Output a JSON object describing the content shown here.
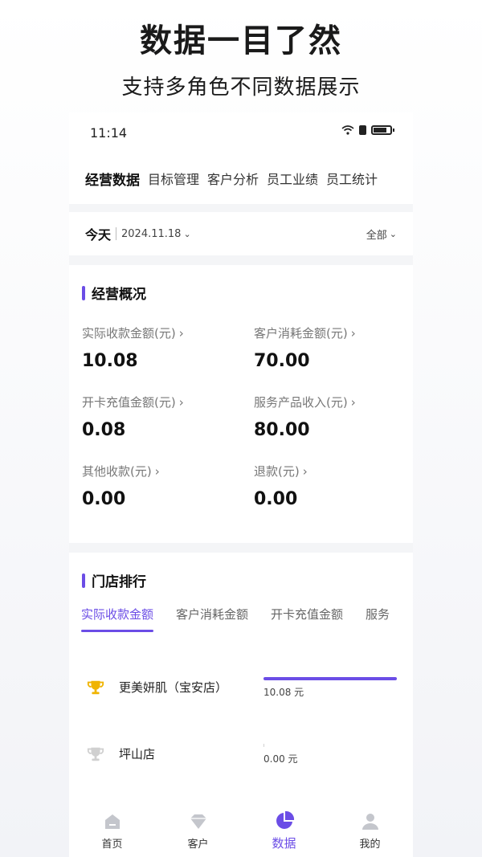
{
  "promo": {
    "title": "数据一目了然",
    "subtitle": "支持多角色不同数据展示"
  },
  "status_bar": {
    "time": "11:14"
  },
  "tabs": [
    {
      "label": "经营数据",
      "active": true
    },
    {
      "label": "目标管理",
      "active": false
    },
    {
      "label": "客户分析",
      "active": false
    },
    {
      "label": "员工业绩",
      "active": false
    },
    {
      "label": "员工统计",
      "active": false
    }
  ],
  "filter": {
    "today_label": "今天",
    "date": "2024.11.18",
    "scope": "全部"
  },
  "overview": {
    "title": "经营概况",
    "metrics": [
      {
        "label": "实际收款金额(元)",
        "value": "10.08"
      },
      {
        "label": "客户消耗金额(元)",
        "value": "70.00"
      },
      {
        "label": "开卡充值金额(元)",
        "value": "0.08"
      },
      {
        "label": "服务产品收入(元)",
        "value": "80.00"
      },
      {
        "label": "其他收款(元)",
        "value": "0.00"
      },
      {
        "label": "退款(元)",
        "value": "0.00"
      }
    ],
    "arrow": "›"
  },
  "ranking": {
    "title": "门店排行",
    "tabs": [
      {
        "label": "实际收款金额",
        "active": true
      },
      {
        "label": "客户消耗金额",
        "active": false
      },
      {
        "label": "开卡充值金额",
        "active": false
      },
      {
        "label": "服务",
        "active": false
      }
    ],
    "rows": [
      {
        "store": "更美妍肌（宝安店）",
        "value_text": "10.08 元",
        "fraction": 1.0,
        "trophy_color": "#f0b400"
      },
      {
        "store": "坪山店",
        "value_text": "0.00 元",
        "fraction": 0.0,
        "trophy_color": "#d0d0d0"
      }
    ]
  },
  "bottom_nav": [
    {
      "label": "首页",
      "icon": "home-icon",
      "active": false
    },
    {
      "label": "客户",
      "icon": "diamond-icon",
      "active": false
    },
    {
      "label": "数据",
      "icon": "pie-chart-icon",
      "active": true
    },
    {
      "label": "我的",
      "icon": "user-icon",
      "active": false
    }
  ],
  "colors": {
    "accent": "#6b4de6",
    "nav_inactive_icon": "#c4c6cc"
  }
}
